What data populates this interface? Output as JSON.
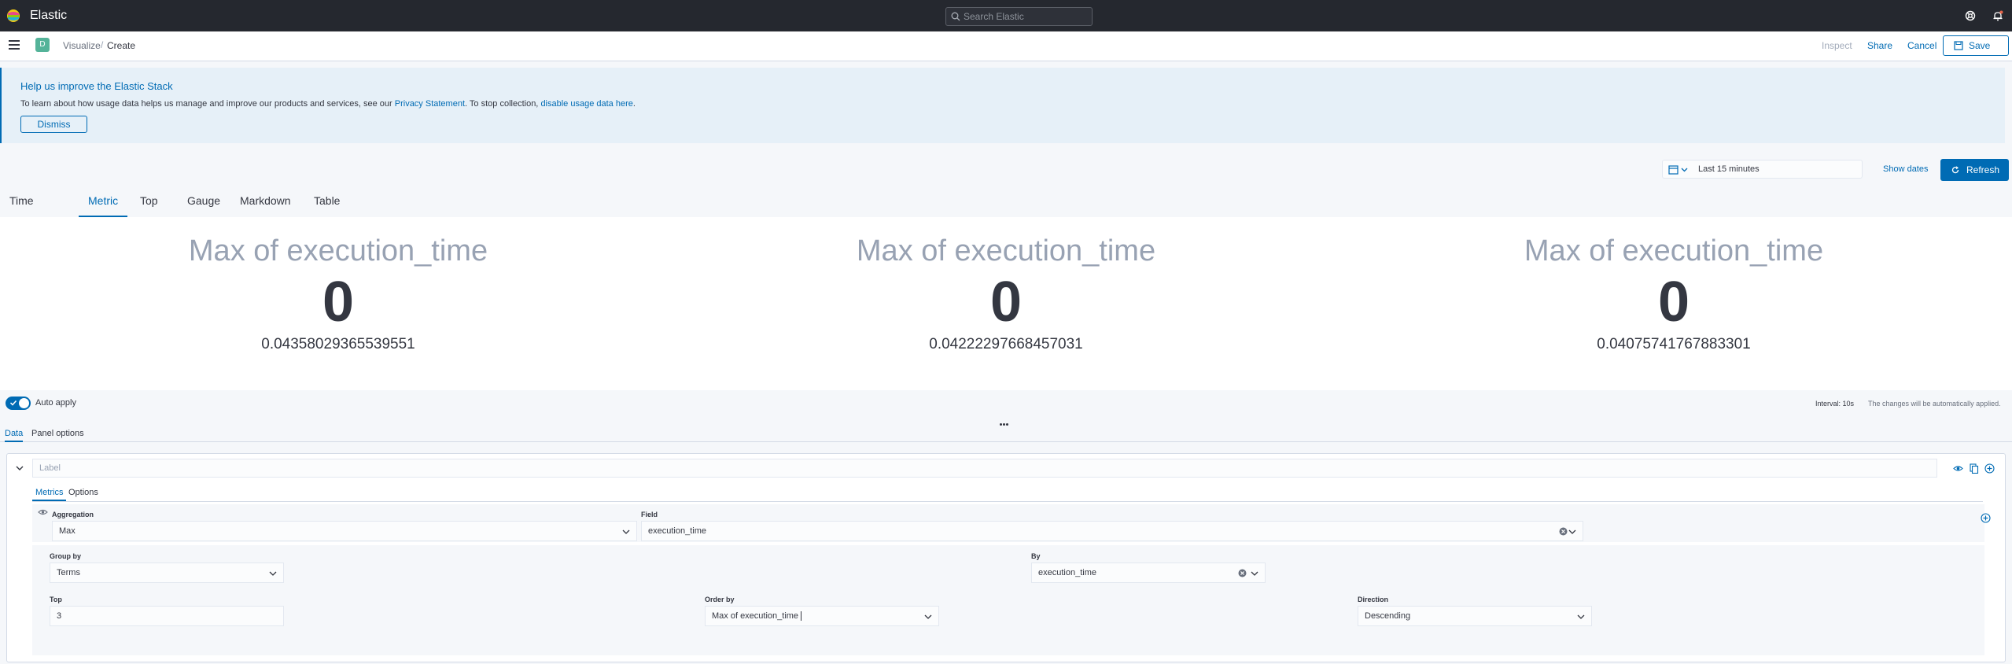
{
  "header": {
    "brand": "Elastic",
    "search_placeholder": "Search Elastic"
  },
  "subheader": {
    "space_initial": "D",
    "breadcrumbs": [
      "Visualize",
      "Create"
    ],
    "breadcrumb_separator": "/",
    "inspect": "Inspect",
    "share": "Share",
    "cancel": "Cancel",
    "save": "Save"
  },
  "callout": {
    "title": "Help us improve the Elastic Stack",
    "text_before": "To learn about how usage data helps us manage and improve our products and services, see our",
    "privacy_link": "Privacy Statement",
    "text_middle": ". To stop collection,",
    "disable_link": "disable usage data here",
    "text_after": ".",
    "dismiss": "Dismiss"
  },
  "time": {
    "range": "Last 15 minutes",
    "show_dates": "Show dates",
    "refresh": "Refresh"
  },
  "vis_tabs": [
    {
      "label": "Time Series",
      "active": false
    },
    {
      "label": "Metric",
      "active": true
    },
    {
      "label": "Top N",
      "active": false
    },
    {
      "label": "Gauge",
      "active": false
    },
    {
      "label": "Markdown",
      "active": false
    },
    {
      "label": "Table",
      "active": false
    }
  ],
  "metrics": [
    {
      "label": "Max of execution_time",
      "value": "0",
      "sub": "0.04358029365539551"
    },
    {
      "label": "Max of execution_time",
      "value": "0",
      "sub": "0.04222297668457031"
    },
    {
      "label": "Max of execution_time",
      "value": "0",
      "sub": "0.04075741767883301"
    }
  ],
  "editor": {
    "auto_apply": "Auto apply",
    "interval": "Interval: 10s",
    "auto_note": "The changes will be automatically applied.",
    "panel_tabs": [
      "Data",
      "Panel options"
    ],
    "series": {
      "label_placeholder": "Label",
      "tabs": [
        "Metrics",
        "Options"
      ],
      "aggregation_label": "Aggregation",
      "aggregation_value": "Max",
      "field_label": "Field",
      "field_value": "execution_time",
      "group_by_label": "Group by",
      "group_by_value": "Terms",
      "by_label": "By",
      "by_value": "execution_time",
      "top_label": "Top",
      "top_value": "3",
      "order_by_label": "Order by",
      "order_by_value": "Max of execution_time",
      "direction_label": "Direction",
      "direction_value": "Descending"
    }
  },
  "colors": {
    "accent": "#006bb4",
    "topbar": "#25282f",
    "callout_bg": "#e6f0f8",
    "metric_label": "#98a2b3"
  }
}
